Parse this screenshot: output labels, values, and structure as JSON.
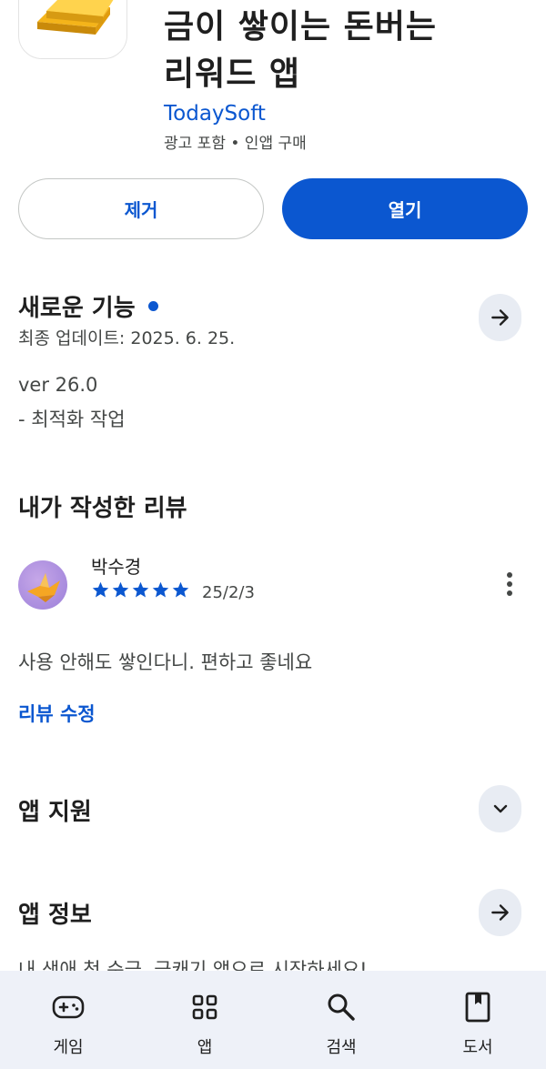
{
  "app": {
    "title_line1": "금이 쌓이는 돈버는",
    "title_line2": "리워드 앱",
    "developer": "TodaySoft",
    "meta": "광고 포함 • 인앱 구매"
  },
  "actions": {
    "uninstall_label": "제거",
    "open_label": "열기"
  },
  "whats_new": {
    "title": "새로운 기능",
    "last_updated": "최종 업데이트: 2025. 6. 25.",
    "version": "ver 26.0",
    "notes": "- 최적화 작업"
  },
  "my_review": {
    "section_title": "내가 작성한 리뷰",
    "reviewer": "박수경",
    "rating": 5,
    "date": "25/2/3",
    "text": "사용 안해도 쌓인다니. 편하고 좋네요",
    "edit_label": "리뷰 수정"
  },
  "app_support": {
    "title": "앱 지원"
  },
  "app_info": {
    "title": "앱 정보",
    "description_clipped": "내 생애 첫 순금, 금캐기 앱으로 시작하세요!"
  },
  "bottom_nav": {
    "items": [
      {
        "label": "게임",
        "icon": "gamepad-icon"
      },
      {
        "label": "앱",
        "icon": "apps-grid-icon"
      },
      {
        "label": "검색",
        "icon": "search-icon"
      },
      {
        "label": "도서",
        "icon": "book-icon"
      }
    ]
  },
  "colors": {
    "accent": "#0b57d0",
    "round_button_bg": "#e8ecf3",
    "nav_bg": "#eef1f8"
  }
}
